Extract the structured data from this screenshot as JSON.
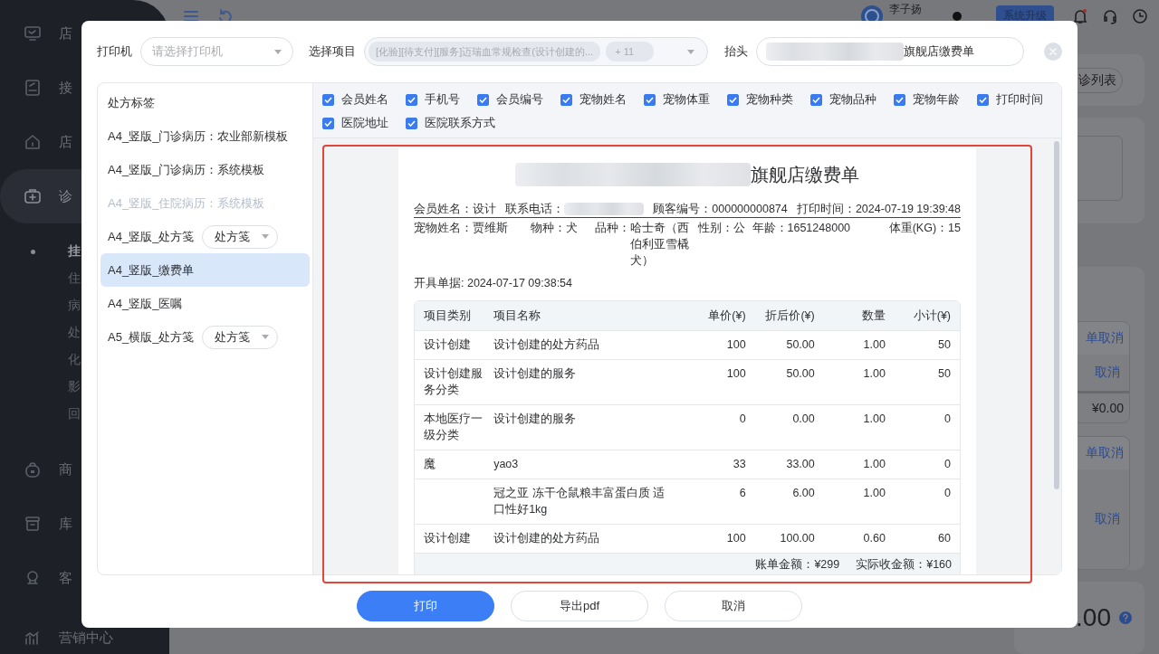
{
  "app": {
    "sidebar": [
      {
        "label": "店",
        "selected": false
      },
      {
        "label": "接",
        "selected": false
      },
      {
        "label": "店",
        "selected": false
      },
      {
        "label": "诊",
        "selected": true,
        "children": [
          {
            "label": "挂",
            "selected": true
          },
          {
            "label": "住",
            "selected": false
          },
          {
            "label": "病",
            "selected": false
          },
          {
            "label": "处",
            "selected": false
          },
          {
            "label": "化",
            "selected": false
          },
          {
            "label": "影",
            "selected": false
          },
          {
            "label": "回",
            "selected": false
          }
        ]
      },
      {
        "label": "商",
        "selected": false
      },
      {
        "label": "库",
        "selected": false
      },
      {
        "label": "客",
        "selected": false
      },
      {
        "label": "营销中心",
        "selected": false
      }
    ],
    "topbar": {
      "user": "李子扬",
      "upgrade_button": "系统升级"
    },
    "right_panel": {
      "list_button": "诊列表",
      "order_cards": [
        {
          "header_action": "单取消",
          "row_action": "取消",
          "amount": "¥0.00"
        },
        {
          "header_action": "单取消",
          "row_action": "取消"
        }
      ],
      "total": ".00"
    }
  },
  "dialog": {
    "printer": {
      "label": "打印机",
      "placeholder": "请选择打印机"
    },
    "items": {
      "label": "选择项目",
      "disabled": true,
      "tags": [
        "[化验][待支付][服务]迈瑞血常规检查(设计创建的...",
        "+ 11"
      ]
    },
    "header_title": {
      "label": "抬头",
      "redacted": true,
      "value": "旗舰店缴费单"
    },
    "templates": [
      {
        "kind": "plain",
        "label": "处方标签",
        "selected": false,
        "disabled": false
      },
      {
        "kind": "plain",
        "label": "A4_竖版_门诊病历：农业部新模板",
        "selected": false,
        "disabled": false
      },
      {
        "kind": "plain",
        "label": "A4_竖版_门诊病历：系统模板",
        "selected": false,
        "disabled": false
      },
      {
        "kind": "plain",
        "label": "A4_竖版_住院病历：系统模板",
        "selected": false,
        "disabled": true
      },
      {
        "kind": "with-select",
        "label": "A4_竖版_处方笺",
        "select": "处方笺",
        "selected": false,
        "disabled": false
      },
      {
        "kind": "plain",
        "label": "A4_竖版_缴费单",
        "selected": true,
        "disabled": false
      },
      {
        "kind": "plain",
        "label": "A4_竖版_医嘱",
        "selected": false,
        "disabled": false
      },
      {
        "kind": "with-select",
        "label": "A5_横版_处方笺",
        "select": "处方笺",
        "selected": false,
        "disabled": false
      }
    ],
    "fields": [
      {
        "label": "会员姓名",
        "checked": true
      },
      {
        "label": "手机号",
        "checked": true
      },
      {
        "label": "会员编号",
        "checked": true
      },
      {
        "label": "宠物姓名",
        "checked": true
      },
      {
        "label": "宠物体重",
        "checked": true
      },
      {
        "label": "宠物种类",
        "checked": true
      },
      {
        "label": "宠物品种",
        "checked": true
      },
      {
        "label": "宠物年龄",
        "checked": true
      },
      {
        "label": "打印时间",
        "checked": true
      },
      {
        "label": "医院地址",
        "checked": true
      },
      {
        "label": "医院联系方式",
        "checked": true
      }
    ],
    "receipt": {
      "title": {
        "redacted": true,
        "text": "旗舰店缴费单"
      },
      "info": [
        {
          "label": "会员姓名：",
          "value": "设计"
        },
        {
          "label": "联系电话：",
          "redacted": true
        },
        {
          "label": "顾客编号：",
          "value": "000000000874"
        },
        {
          "label": "打印时间：",
          "value": "2024-07-19 19:39:48"
        }
      ],
      "pet": [
        {
          "label": "宠物姓名：",
          "value": "贾维斯"
        },
        {
          "label": "物种：",
          "value": "犬"
        },
        {
          "label": "品种：",
          "value": "哈士奇（西伯利亚雪橇犬）"
        },
        {
          "label": "性别：",
          "value": "公"
        },
        {
          "label": "年龄：",
          "value": "1651248000"
        },
        {
          "label": "体重(KG)：",
          "value": "15"
        }
      ],
      "issued": "开具单据: 2024-07-17 09:38:54",
      "table": {
        "columns": [
          "项目类别",
          "项目名称",
          "单价(¥)",
          "折后价(¥)",
          "数量",
          "小计(¥)"
        ],
        "rows": [
          [
            "设计创建",
            "设计创建的处方药品",
            "100",
            "50.00",
            "1.00",
            "50"
          ],
          [
            "设计创建服务分类",
            "设计创建的服务",
            "100",
            "50.00",
            "1.00",
            "50"
          ],
          [
            "本地医疗一级分类",
            "设计创建的服务",
            "0",
            "0.00",
            "1.00",
            "0"
          ],
          [
            "魔",
            "yao3",
            "33",
            "33.00",
            "1.00",
            "0"
          ],
          [
            null,
            "冠之亚 冻干仓鼠粮丰富蛋白质 适口性好1kg",
            "6",
            "6.00",
            "1.00",
            "0"
          ],
          [
            "设计创建",
            "设计创建的处方药品",
            "100",
            "100.00",
            "0.60",
            "60"
          ]
        ]
      },
      "totals": [
        "账单金额：¥299",
        "实际收金额：¥160"
      ]
    },
    "buttons": [
      {
        "label": "打印",
        "kind": "primary"
      },
      {
        "label": "导出pdf",
        "kind": "default"
      },
      {
        "label": "取消",
        "kind": "default"
      }
    ]
  }
}
